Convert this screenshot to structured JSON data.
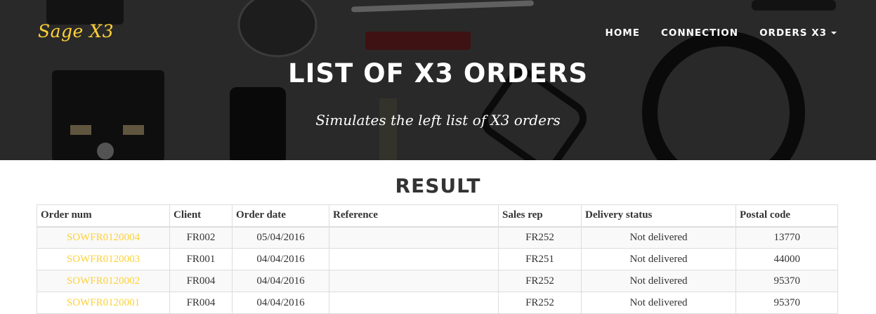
{
  "header": {
    "brand": "Sage X3",
    "nav": [
      {
        "label": "HOME"
      },
      {
        "label": "CONNECTION"
      },
      {
        "label": "ORDERS X3"
      }
    ],
    "title": "LIST OF X3 ORDERS",
    "subtitle": "Simulates the left list of X3 orders"
  },
  "result": {
    "heading": "RESULT",
    "columns": [
      "Order num",
      "Client",
      "Order date",
      "Reference",
      "Sales rep",
      "Delivery status",
      "Postal code"
    ],
    "rows": [
      {
        "order_num": "SOWFR0120004",
        "client": "FR002",
        "order_date": "05/04/2016",
        "reference": "",
        "sales_rep": "FR252",
        "delivery_status": "Not delivered",
        "postal_code": "13770"
      },
      {
        "order_num": "SOWFR0120003",
        "client": "FR001",
        "order_date": "04/04/2016",
        "reference": "",
        "sales_rep": "FR251",
        "delivery_status": "Not delivered",
        "postal_code": "44000"
      },
      {
        "order_num": "SOWFR0120002",
        "client": "FR004",
        "order_date": "04/04/2016",
        "reference": "",
        "sales_rep": "FR252",
        "delivery_status": "Not delivered",
        "postal_code": "95370"
      },
      {
        "order_num": "SOWFR0120001",
        "client": "FR004",
        "order_date": "04/04/2016",
        "reference": "",
        "sales_rep": "FR252",
        "delivery_status": "Not delivered",
        "postal_code": "95370"
      }
    ]
  },
  "colors": {
    "accent": "#fed136",
    "text": "#333333",
    "border": "#dddddd"
  }
}
